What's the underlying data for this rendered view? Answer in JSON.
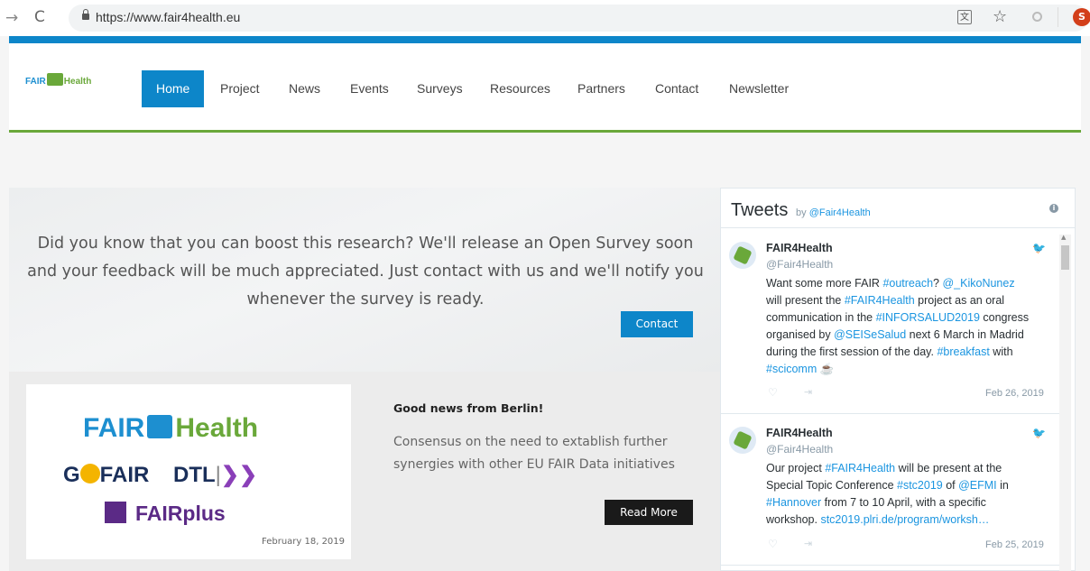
{
  "browser": {
    "url": "https://www.fair4health.eu",
    "avatar_letter": "S",
    "translate_glyph": "文"
  },
  "site": {
    "logo": {
      "left": "FAIR",
      "right": "Health"
    },
    "nav": {
      "items": [
        "Home",
        "Project",
        "News",
        "Events",
        "Surveys",
        "Resources",
        "Partners",
        "Contact",
        "Newsletter"
      ],
      "active": "Home"
    },
    "colors": {
      "brand_blue": "#0d86c9",
      "brand_green": "#6aa83a"
    }
  },
  "banner": {
    "text": "Did you know that you can boost this research? We'll release an Open Survey soon and your feedback will be much appreciated. Just contact with us and we'll notify you whenever the survey is ready.",
    "button_label": "Contact"
  },
  "news": {
    "image_logos": {
      "fair4health_left": "FAIR",
      "fair4health_right": "Health",
      "gofair_go": "G",
      "gofair_fair": "FAIR",
      "dtl": "DTL",
      "dtl_sep": "|",
      "fairplus": "FAIRplus"
    },
    "date": "February 18, 2019",
    "title": "Good news from Berlin!",
    "excerpt": "Consensus on the need to extablish further synergies with other EU FAIR Data initiatives",
    "button_label": "Read More"
  },
  "twitter": {
    "title": "Tweets",
    "by_prefix": "by",
    "by_handle": "@Fair4Health",
    "tweets": [
      {
        "name": "FAIR4Health",
        "handle": "@Fair4Health",
        "text_parts": [
          "Want some more FAIR ",
          "#outreach",
          "? ",
          "@_KikoNunez",
          " will present the ",
          "#FAIR4Health",
          " project as an oral communication in the ",
          "#INFORSALUD2019",
          " congress organised by ",
          "@SEISeSalud",
          " next 6 March in Madrid during the first session of the day. ",
          "#breakfast",
          " with ",
          "#scicomm",
          " ☕"
        ],
        "date": "Feb 26, 2019"
      },
      {
        "name": "FAIR4Health",
        "handle": "@Fair4Health",
        "text_parts": [
          "Our project ",
          "#FAIR4Health",
          " will be present at the Special Topic Conference ",
          "#stc2019",
          " of ",
          "@EFMI",
          " in ",
          "#Hannover",
          " from 7 to 10 April, with a specific workshop. ",
          "stc2019.plri.de/program/worksh…"
        ],
        "date": "Feb 25, 2019"
      }
    ]
  }
}
